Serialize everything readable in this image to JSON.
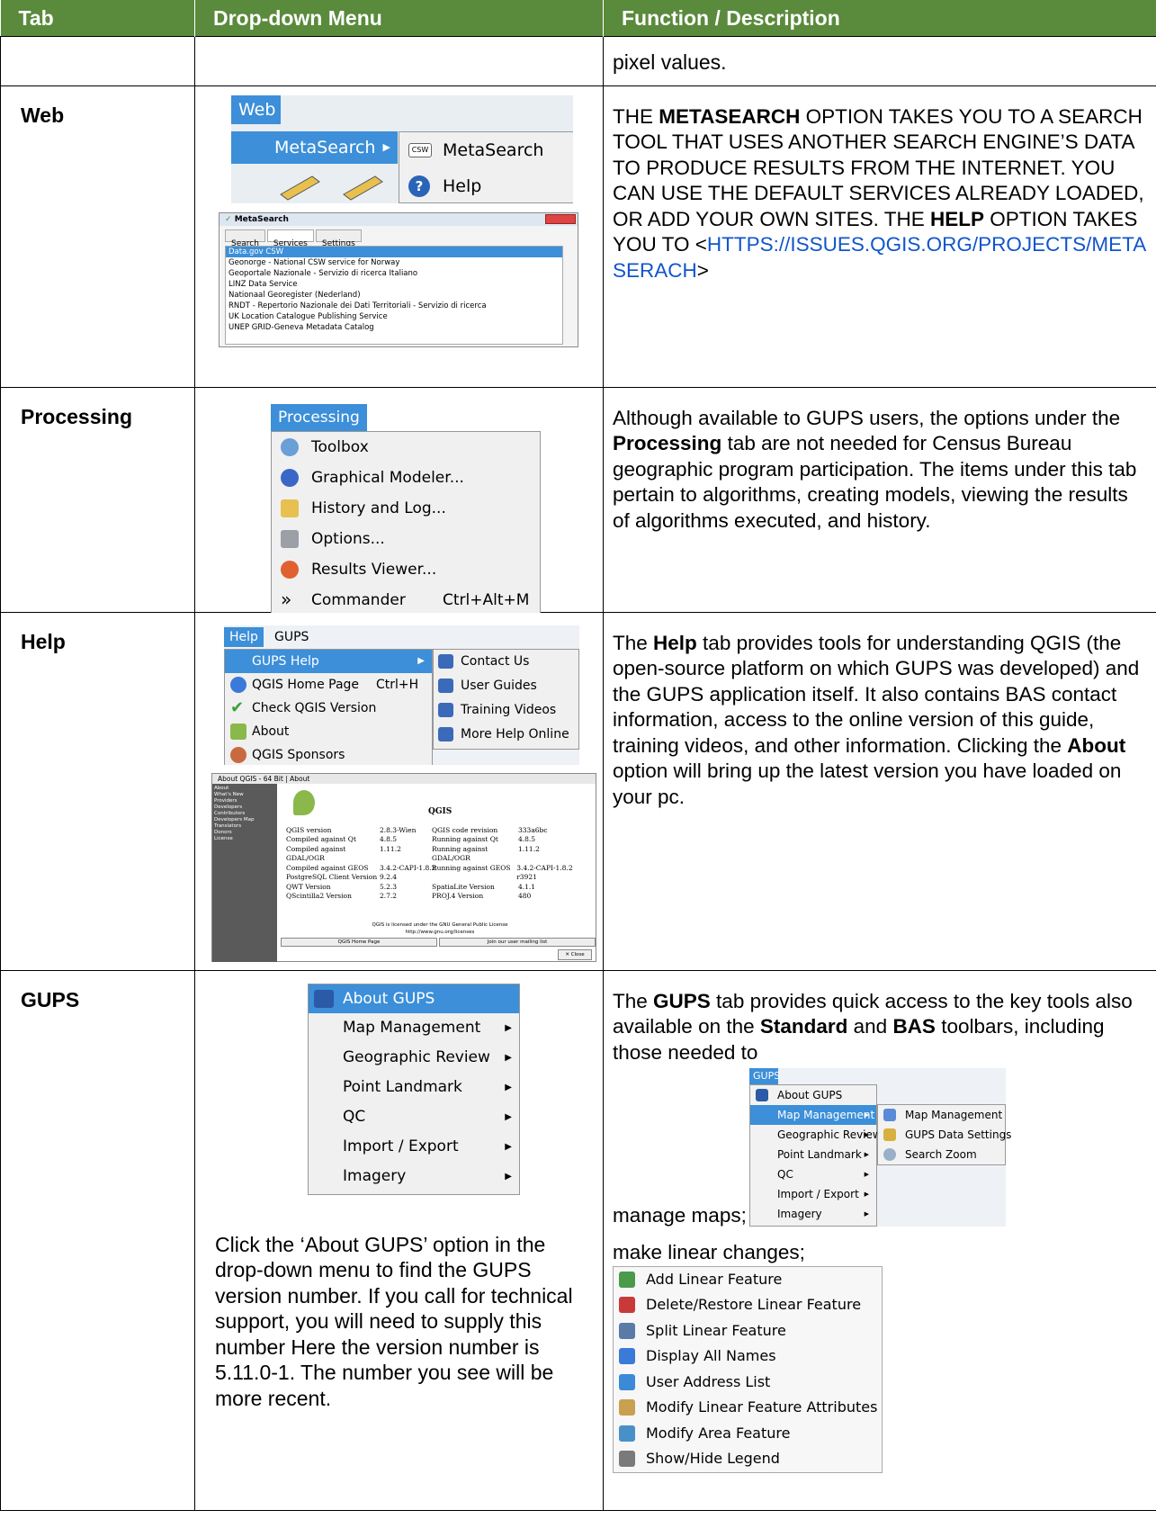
{
  "headers": {
    "tab": "Tab",
    "menu": "Drop-down Menu",
    "desc": "Function / Description"
  },
  "row0": {
    "desc": "pixel values."
  },
  "web": {
    "tab": "Web",
    "menubar": "Web",
    "metasearch_item": "MetaSearch",
    "sub_items": [
      "MetaSearch",
      "Help"
    ],
    "window": {
      "title": "MetaSearch",
      "tabs": [
        "Search",
        "Services",
        "Settings"
      ],
      "services": [
        "Data.gov CSW",
        "Geonorge - National CSW service for Norway",
        "Geoportale Nazionale - Servizio di ricerca Italiano",
        "LINZ Data Service",
        "Nationaal Georegister (Nederland)",
        "RNDT - Repertorio Nazionale dei Dati Territoriali - Servizio di ricerca",
        "UK Location Catalogue Publishing Service",
        "UNEP GRID-Geneva Metadata Catalog"
      ]
    },
    "desc_parts": [
      "THE ",
      "METASEARCH",
      " OPTION TAKES YOU TO A SEARCH TOOL THAT USES ANOTHER SEARCH ENGINE’S DATA TO PRODUCE RESULTS FROM THE INTERNET. YOU CAN USE THE DEFAULT SERVICES ALREADY LOADED, OR ADD YOUR OWN SITES. THE ",
      "HELP",
      " OPTION TAKES YOU TO <",
      "HTTPS://ISSUES.QGIS.ORG/PROJECTS/METASERACH",
      ">"
    ]
  },
  "processing": {
    "tab": "Processing",
    "menubar": "Processing",
    "items": [
      "Toolbox",
      "Graphical Modeler...",
      "History and Log...",
      "Options...",
      "Results Viewer...",
      "Commander"
    ],
    "shortcut": "Ctrl+Alt+M",
    "desc_parts": [
      "Although available to GUPS users, the options under the ",
      "Processing",
      " tab are not needed for Census Bureau geographic program participation. The items under this tab pertain to algorithms, creating models, viewing the results of algorithms executed, and history."
    ]
  },
  "help": {
    "tab": "Help",
    "menubar": [
      "Help",
      "GUPS"
    ],
    "items": [
      "GUPS Help",
      "QGIS Home Page",
      "Check QGIS Version",
      "About",
      "QGIS Sponsors"
    ],
    "home_shortcut": "Ctrl+H",
    "sub_items": [
      "Contact Us",
      "User Guides",
      "Training Videos",
      "More Help Online"
    ],
    "about": {
      "title": "About QGIS - 64 Bit | About",
      "heading": "QGIS",
      "nav": [
        "About",
        "What's New",
        "Providers",
        "Developers",
        "Contributors",
        "Developers Map",
        "Translators",
        "Donors",
        "License"
      ],
      "left_keys": [
        "QGIS version",
        "Compiled against Qt",
        "Compiled against GDAL/OGR",
        "Compiled against GEOS",
        "PostgreSQL Client Version",
        "QWT Version",
        "QScintilla2 Version"
      ],
      "left_vals": [
        "2.8.3-Wien",
        "4.8.5",
        "1.11.2",
        "3.4.2-CAPI-1.8.2",
        "9.2.4",
        "5.2.3",
        "2.7.2"
      ],
      "right_keys": [
        "QGIS code revision",
        "Running against Qt",
        "Running against GDAL/OGR",
        "Running against GEOS",
        "SpatiaLite Version",
        "PROJ.4 Version"
      ],
      "right_vals": [
        "333a6bc",
        "4.8.5",
        "1.11.2",
        "3.4.2-CAPI-1.8.2 r3921",
        "4.1.1",
        "480"
      ],
      "license": "QGIS is licensed under the GNU General Public License",
      "url": "http://www.gnu.org/licenses",
      "btn_home": "QGIS Home Page",
      "btn_join": "Join our user mailing list",
      "btn_close": "Close"
    },
    "desc_parts": [
      "The ",
      "Help",
      " tab provides tools for understanding QGIS (the open-source platform on which GUPS was developed) and the GUPS application itself. It also contains BAS contact information, access to the online version of this guide, training videos, and other information. Clicking the ",
      "About",
      " option will bring up the latest version you have loaded on your pc."
    ]
  },
  "gups": {
    "tab": "GUPS",
    "items": [
      "About GUPS",
      "Map Management",
      "Geographic Review",
      "Point Landmark",
      "QC",
      "Import / Export",
      "Imagery"
    ],
    "note": "Click the ‘About GUPS’ option in the drop-down menu to find the GUPS version number. If you call for technical support, you will need to supply this number Here the version number is 5.11.0-1. The number you see will be more recent.",
    "desc_parts": [
      "The ",
      "GUPS",
      " tab provides quick access to the key tools also available on the ",
      "Standard",
      " and ",
      "BAS",
      " toolbars, including those needed to"
    ],
    "mini_menubar": "GUPS",
    "mini_items": [
      "About GUPS",
      "Map Management",
      "Geographic Review",
      "Point Landmark",
      "QC",
      "Import / Export",
      "Imagery"
    ],
    "mini_sub": [
      "Map Management",
      "GUPS Data Settings",
      "Search Zoom"
    ],
    "manage_maps": "manage maps;",
    "linear_label": "make linear changes;",
    "tools": [
      "Add Linear Feature",
      "Delete/Restore Linear Feature",
      "Split Linear Feature",
      "Display All Names",
      "User Address List",
      "Modify Linear Feature Attributes",
      "Modify Area Feature",
      "Show/Hide Legend"
    ]
  }
}
